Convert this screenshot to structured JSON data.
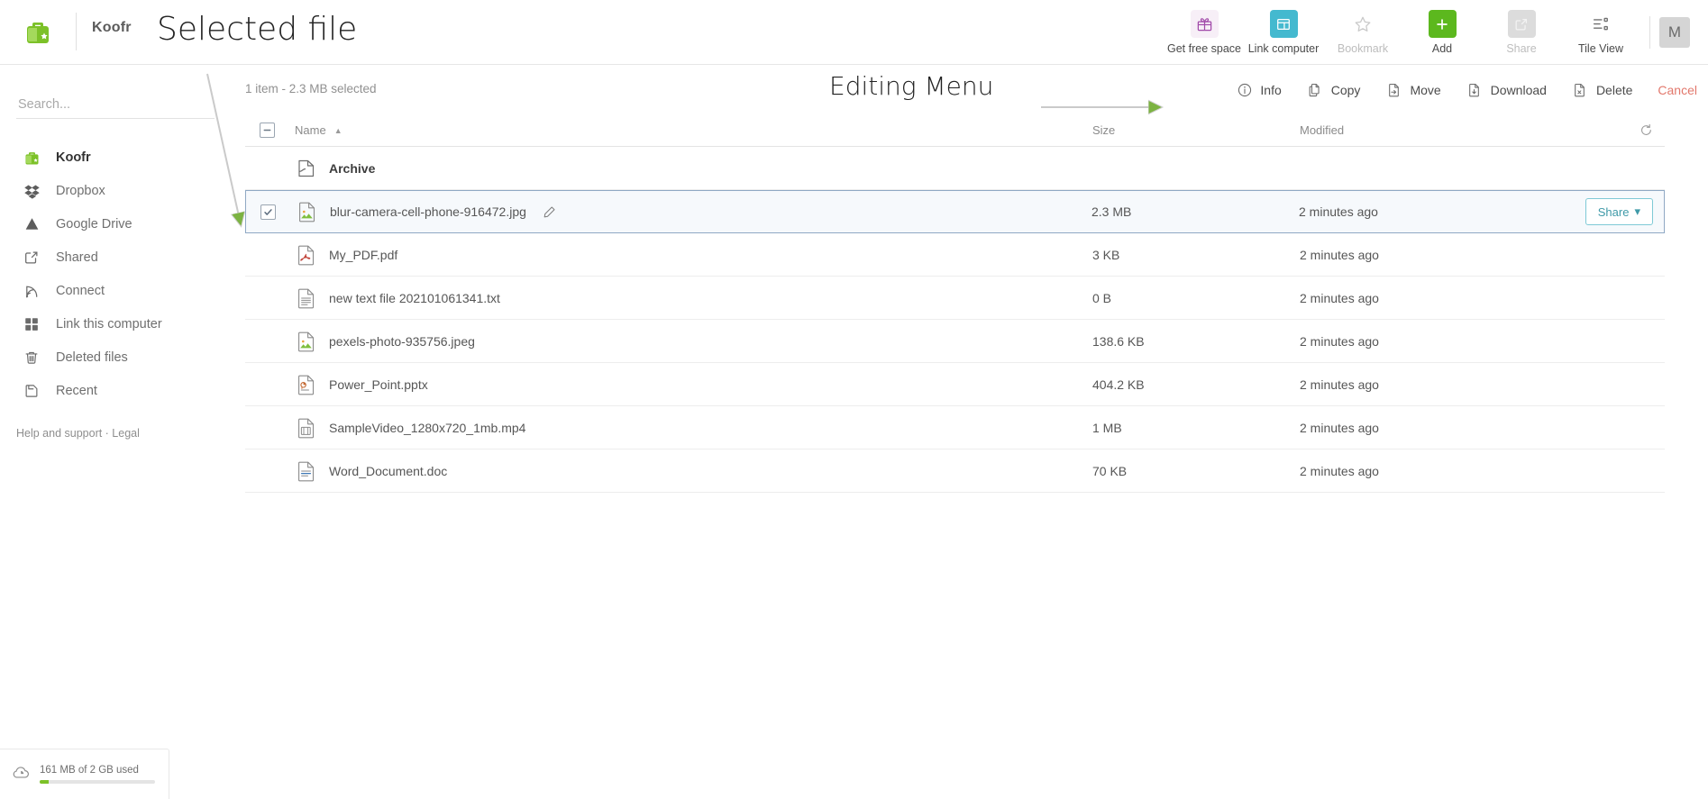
{
  "app": {
    "brand": "Koofr",
    "logo_icon": "koofr-bag-icon"
  },
  "annotations": {
    "selected_file": "Selected file",
    "editing_menu": "Editing Menu",
    "arrow_color": "#7cb342",
    "line_color": "#c9c9c9"
  },
  "topbar": {
    "items": [
      {
        "label": "Get free space",
        "icon": "gift-icon",
        "dim": false
      },
      {
        "label": "Link computer",
        "icon": "window-link-icon",
        "dim": false
      },
      {
        "label": "Bookmark",
        "icon": "star-icon",
        "dim": true
      },
      {
        "label": "Add",
        "icon": "plus-icon",
        "dim": false
      },
      {
        "label": "Share",
        "icon": "share-square-icon",
        "dim": true
      },
      {
        "label": "Tile View",
        "icon": "tile-view-icon",
        "dim": false
      }
    ],
    "avatar_initial": "M"
  },
  "sidebar": {
    "search_placeholder": "Search...",
    "search_value": "",
    "items": [
      {
        "label": "Koofr",
        "icon": "koofr-bag-icon",
        "active": true
      },
      {
        "label": "Dropbox",
        "icon": "dropbox-icon",
        "active": false
      },
      {
        "label": "Google Drive",
        "icon": "google-drive-icon",
        "active": false
      },
      {
        "label": "Shared",
        "icon": "shared-external-icon",
        "active": false
      },
      {
        "label": "Connect",
        "icon": "rss-connect-icon",
        "active": false
      },
      {
        "label": "Link this computer",
        "icon": "grid-squares-icon",
        "active": false
      },
      {
        "label": "Deleted files",
        "icon": "trash-icon",
        "active": false
      },
      {
        "label": "Recent",
        "icon": "recent-clock-icon",
        "active": false
      }
    ],
    "footer_links": "Help and support · Legal",
    "storage": {
      "icon": "cloud-pie-icon",
      "text": "161 MB of 2 GB used",
      "percent": 8,
      "fill_color": "#7cc128"
    }
  },
  "main": {
    "selection_summary": "1 item - 2.3 MB selected",
    "editing_menu": [
      {
        "label": "Info",
        "icon": "info-circle-icon"
      },
      {
        "label": "Copy",
        "icon": "copy-icon"
      },
      {
        "label": "Move",
        "icon": "move-arrow-icon"
      },
      {
        "label": "Download",
        "icon": "download-icon"
      },
      {
        "label": "Delete",
        "icon": "delete-x-icon"
      },
      {
        "label": "Cancel",
        "icon": ""
      }
    ],
    "cancel_color": "#e2786c",
    "table": {
      "header_checkbox_state": "indeterminate",
      "columns": {
        "name": "Name",
        "size": "Size",
        "modified": "Modified"
      },
      "sort": {
        "column": "Name",
        "direction": "asc",
        "glyph": "▲"
      },
      "refresh_icon": "refresh-icon",
      "rows": [
        {
          "name": "Archive",
          "size": "",
          "modified": "",
          "icon": "folder-archive-icon",
          "type": "folder",
          "selected": false
        },
        {
          "name": "blur-camera-cell-phone-916472.jpg",
          "size": "2.3 MB",
          "modified": "2 minutes ago",
          "icon": "image-file-icon",
          "type": "image",
          "selected": true,
          "has_edit_pencil": true,
          "share_label": "Share"
        },
        {
          "name": "My_PDF.pdf",
          "size": "3 KB",
          "modified": "2 minutes ago",
          "icon": "pdf-file-icon",
          "type": "pdf",
          "selected": false
        },
        {
          "name": "new text file 202101061341.txt",
          "size": "0 B",
          "modified": "2 minutes ago",
          "icon": "text-file-icon",
          "type": "text",
          "selected": false
        },
        {
          "name": "pexels-photo-935756.jpeg",
          "size": "138.6 KB",
          "modified": "2 minutes ago",
          "icon": "image-file-icon",
          "type": "image",
          "selected": false
        },
        {
          "name": "Power_Point.pptx",
          "size": "404.2 KB",
          "modified": "2 minutes ago",
          "icon": "pptx-file-icon",
          "type": "pptx",
          "selected": false
        },
        {
          "name": "SampleVideo_1280x720_1mb.mp4",
          "size": "1 MB",
          "modified": "2 minutes ago",
          "icon": "video-file-icon",
          "type": "video",
          "selected": false
        },
        {
          "name": "Word_Document.doc",
          "size": "70 KB",
          "modified": "2 minutes ago",
          "icon": "doc-file-icon",
          "type": "doc",
          "selected": false
        }
      ]
    }
  },
  "colors": {
    "brand_green": "#5cb81e",
    "teal": "#44b9cf",
    "selected_row_bg": "#f6f9fc",
    "selected_row_border": "#8fa8c4"
  }
}
